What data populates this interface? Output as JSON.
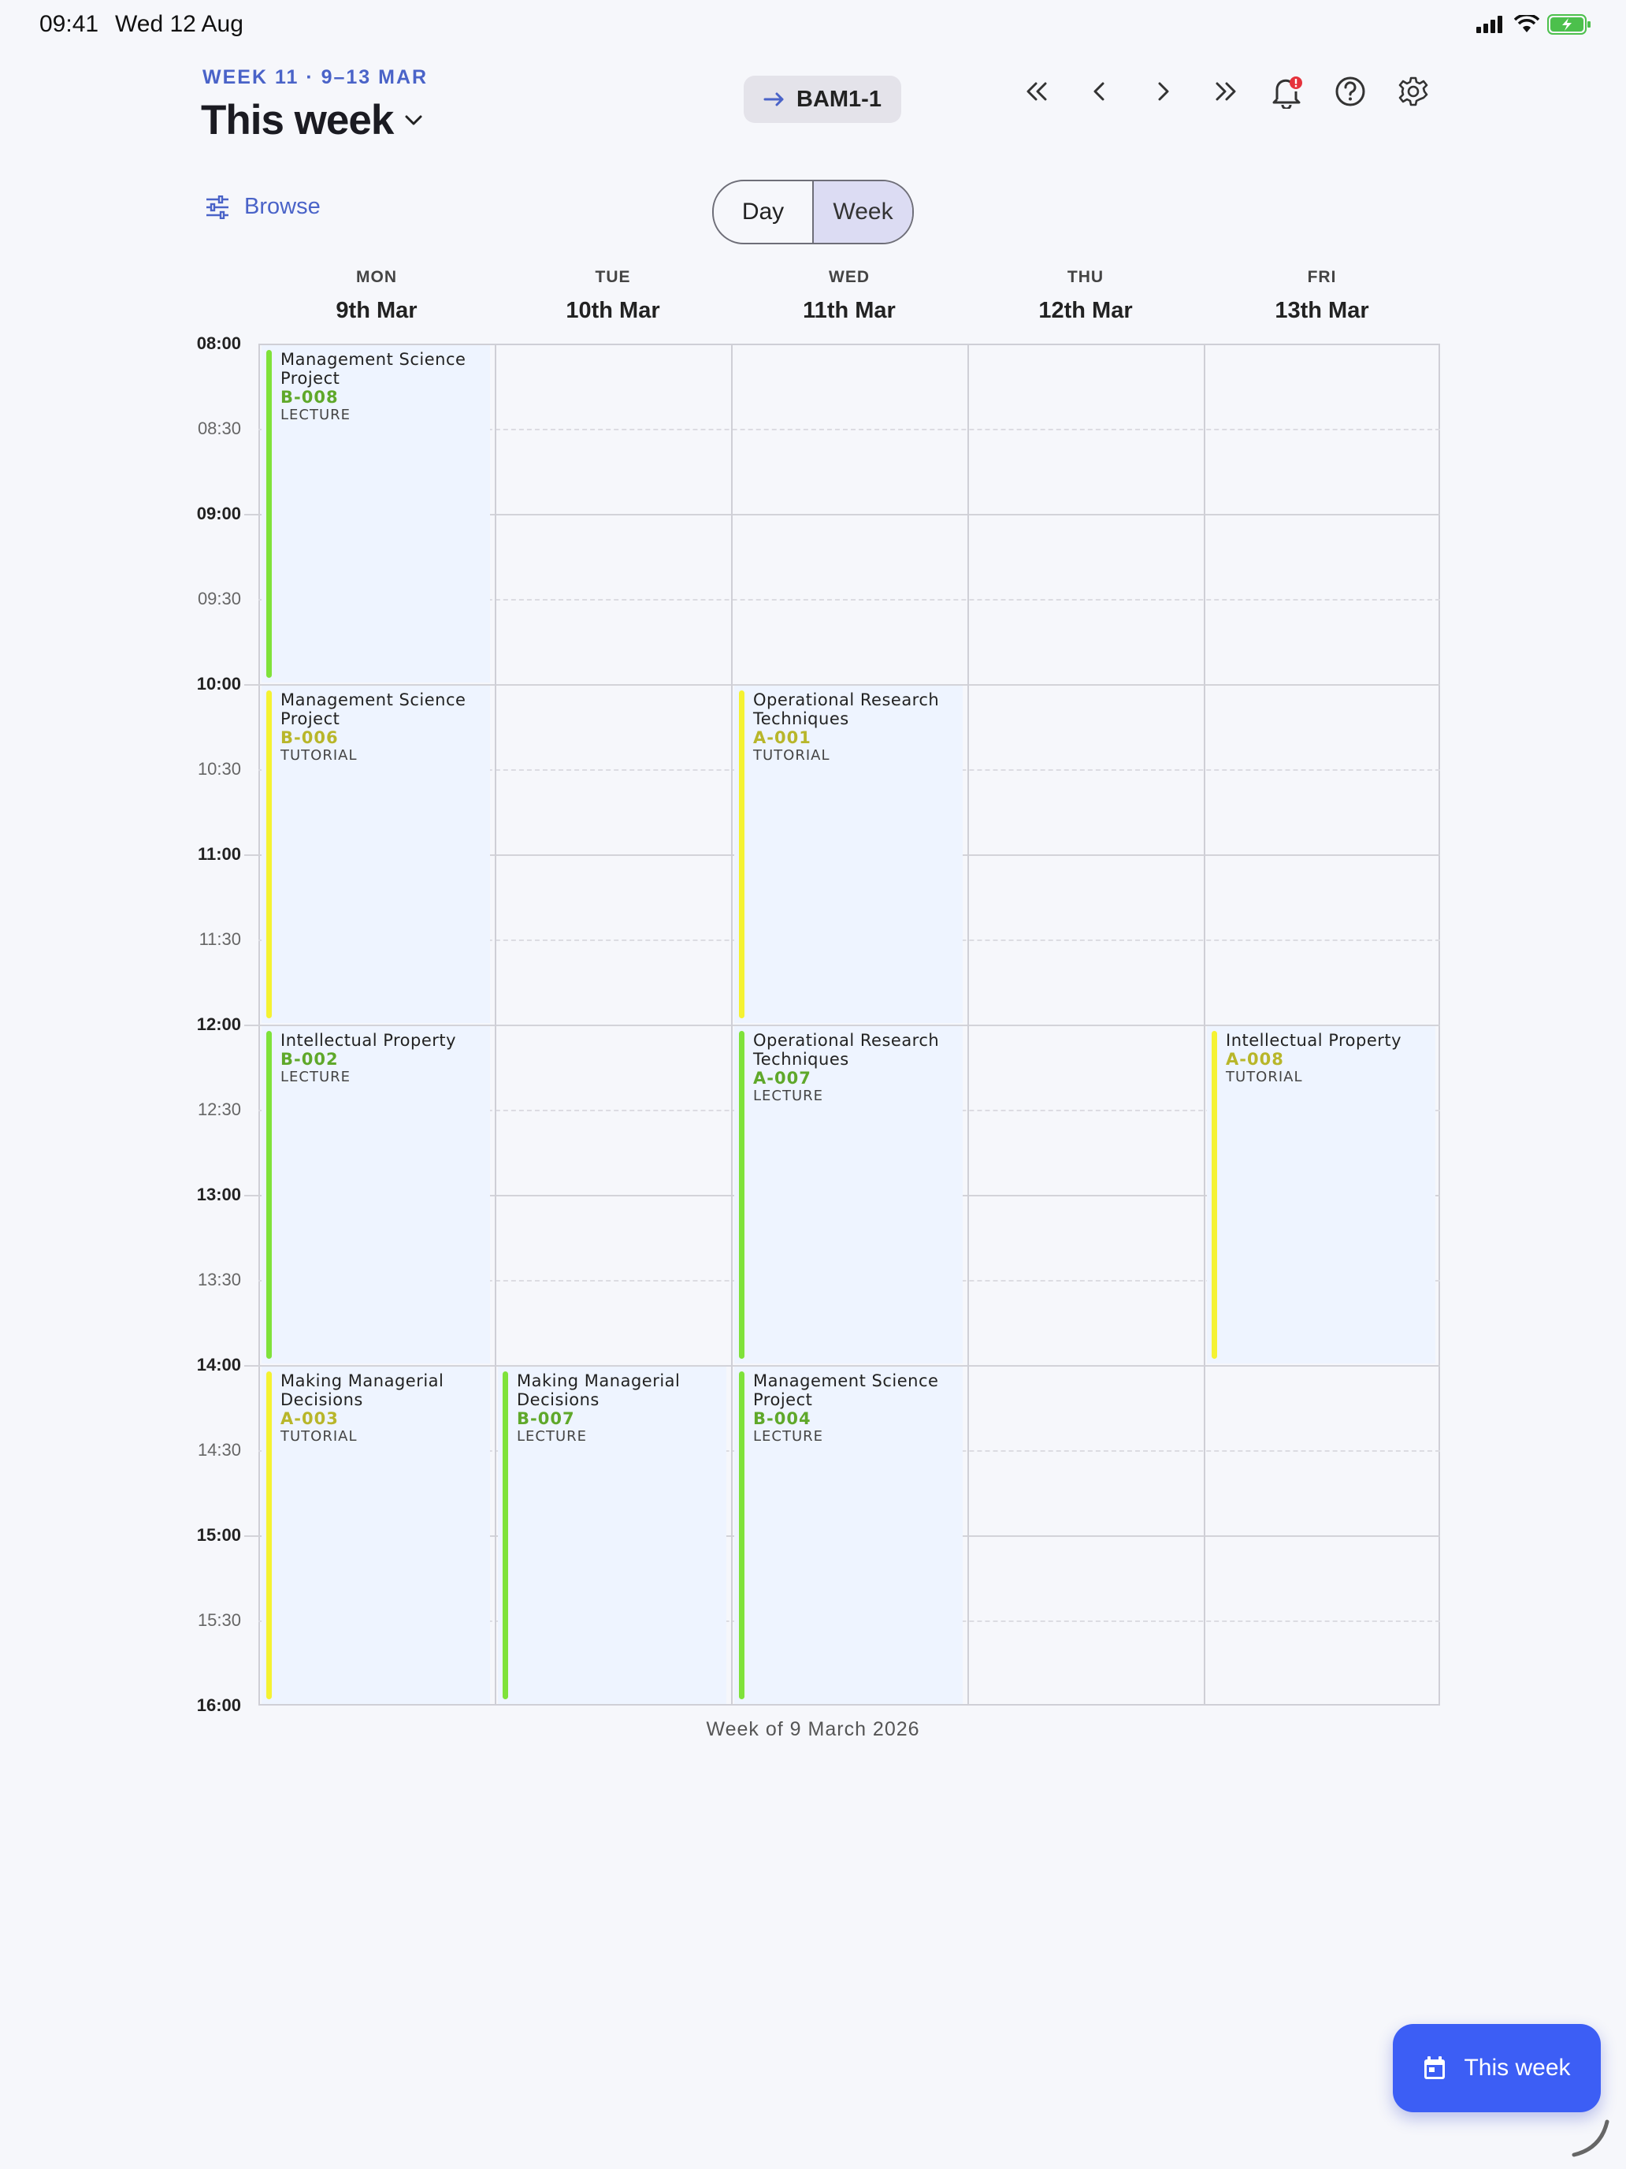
{
  "status_bar": {
    "time": "09:41",
    "date": "Wed 12 Aug"
  },
  "header": {
    "week_label": "WEEK 11 · 9–13 MAR",
    "title": "This week",
    "group": "BAM1-1"
  },
  "browse_label": "Browse",
  "view_toggle": {
    "day": "Day",
    "week": "Week",
    "selected": "Week"
  },
  "days": [
    {
      "name": "MON",
      "date": "9th Mar"
    },
    {
      "name": "TUE",
      "date": "10th Mar"
    },
    {
      "name": "WED",
      "date": "11th Mar"
    },
    {
      "name": "THU",
      "date": "12th Mar"
    },
    {
      "name": "FRI",
      "date": "13th Mar"
    }
  ],
  "times": [
    "08:00",
    "08:30",
    "09:00",
    "09:30",
    "10:00",
    "10:30",
    "11:00",
    "11:30",
    "12:00",
    "12:30",
    "13:00",
    "13:30",
    "14:00",
    "14:30",
    "15:00",
    "15:30",
    "16:00"
  ],
  "events": [
    {
      "day": 0,
      "start": "08:00",
      "end": "10:00",
      "title": "Management Science Project",
      "room": "B-008",
      "type": "LECTURE"
    },
    {
      "day": 0,
      "start": "10:00",
      "end": "12:00",
      "title": "Management Science Project",
      "room": "B-006",
      "type": "TUTORIAL"
    },
    {
      "day": 0,
      "start": "12:00",
      "end": "14:00",
      "title": "Intellectual Property",
      "room": "B-002",
      "type": "LECTURE"
    },
    {
      "day": 0,
      "start": "14:00",
      "end": "16:00",
      "title": "Making Managerial Decisions",
      "room": "A-003",
      "type": "TUTORIAL"
    },
    {
      "day": 1,
      "start": "14:00",
      "end": "16:00",
      "title": "Making Managerial Decisions",
      "room": "B-007",
      "type": "LECTURE"
    },
    {
      "day": 2,
      "start": "10:00",
      "end": "12:00",
      "title": "Operational Research Techniques",
      "room": "A-001",
      "type": "TUTORIAL"
    },
    {
      "day": 2,
      "start": "12:00",
      "end": "14:00",
      "title": "Operational Research Techniques",
      "room": "A-007",
      "type": "LECTURE"
    },
    {
      "day": 2,
      "start": "14:00",
      "end": "16:00",
      "title": "Management Science Project",
      "room": "B-004",
      "type": "LECTURE"
    },
    {
      "day": 4,
      "start": "12:00",
      "end": "14:00",
      "title": "Intellectual Property",
      "room": "A-008",
      "type": "TUTORIAL"
    }
  ],
  "footer_note": "Week of 9 March 2026",
  "fab_label": "This week",
  "colors": {
    "accent": "#3c5ef5",
    "lecture": "#7fe23a",
    "tutorial": "#f5f232",
    "notification": "#e5323c"
  },
  "icons": [
    "signal-icon",
    "wifi-icon",
    "battery-charging-icon",
    "arrow-right-icon",
    "chevron-down-icon",
    "double-chevron-left-icon",
    "chevron-left-icon",
    "chevron-right-icon",
    "double-chevron-right-icon",
    "bell-alert-icon",
    "help-icon",
    "gear-icon",
    "sliders-icon",
    "calendar-icon"
  ]
}
